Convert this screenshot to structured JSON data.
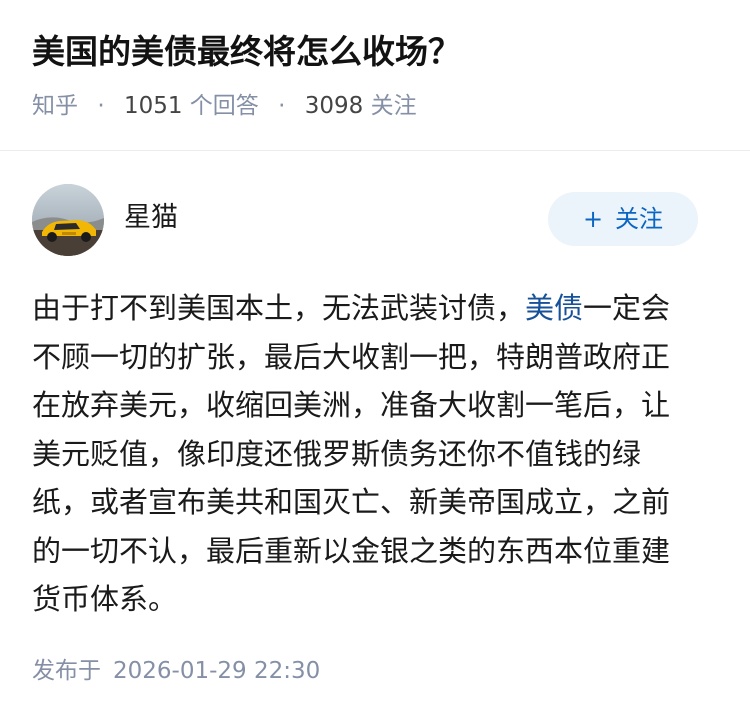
{
  "question": {
    "title": "美国的美债最终将怎么收场？",
    "site": "知乎",
    "separator": "·",
    "answer_count": "1051",
    "answer_label": "个回答",
    "follower_count": "3098",
    "follower_label": "关注"
  },
  "author": {
    "name": "星猫",
    "avatar_icon": "avatar-yellow-sports-car",
    "follow_button": {
      "icon": "+",
      "label": "关注"
    }
  },
  "answer": {
    "lines": [
      {
        "before": "由于打不到美国本土，无法武装讨债，",
        "link": "美债",
        "after": "一定会"
      },
      {
        "text": "不顾一切的扩张，最后大收割一把，特朗普政府正"
      },
      {
        "text": "在放弃美元，收缩回美洲，准备大收割一笔后，让"
      },
      {
        "text": "美元贬值，像印度还俄罗斯债务还你不值钱的绿"
      },
      {
        "text": "纸，或者宣布美共和国灭亡、新美帝国成立，之前"
      },
      {
        "text": "的一切不认，最后重新以金银之类的东西本位重建"
      },
      {
        "text": "货币体系。"
      }
    ]
  },
  "footer": {
    "published_label": "发布于",
    "published_time": "2026-01-29 22:30"
  },
  "colors": {
    "link": "#175199",
    "follow_button_bg": "#ebf3fb",
    "follow_button_text": "#0a66c2",
    "meta_text": "#8590a6"
  }
}
